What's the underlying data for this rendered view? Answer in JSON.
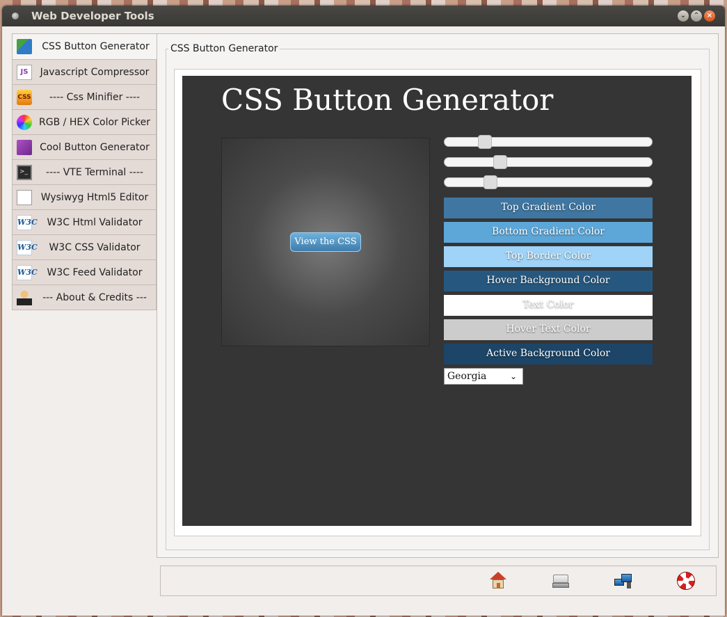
{
  "window": {
    "title": "Web Developer Tools"
  },
  "sidebar": {
    "items": [
      {
        "label": "CSS Button Generator",
        "icon": "css-button-icon",
        "active": true
      },
      {
        "label": "Javascript Compressor",
        "icon": "js-icon"
      },
      {
        "label": "---- Css Minifier ----",
        "icon": "css-icon"
      },
      {
        "label": "RGB / HEX Color Picker",
        "icon": "color-wheel-icon"
      },
      {
        "label": "Cool Button Generator",
        "icon": "cool-button-icon"
      },
      {
        "label": "---- VTE Terminal ----",
        "icon": "terminal-icon"
      },
      {
        "label": "Wysiwyg Html5 Editor",
        "icon": "editor-icon"
      },
      {
        "label": "W3C Html Validator",
        "icon": "w3c-icon"
      },
      {
        "label": "W3C CSS Validator",
        "icon": "w3c-icon"
      },
      {
        "label": "W3C Feed Validator",
        "icon": "w3c-icon"
      },
      {
        "label": "--- About & Credits ---",
        "icon": "person-icon"
      }
    ]
  },
  "main": {
    "group_title": "CSS Button Generator",
    "heading": "CSS Button Generator",
    "preview_button": "View the CSS",
    "sliders": [
      {
        "name": "slider-1",
        "fraction": 0.17
      },
      {
        "name": "slider-2",
        "fraction": 0.25
      },
      {
        "name": "slider-3",
        "fraction": 0.2
      }
    ],
    "color_buttons": [
      {
        "label": "Top Gradient Color",
        "color": "#3f77a2"
      },
      {
        "label": "Bottom Gradient Color",
        "color": "#5da7d8"
      },
      {
        "label": "Top Border Color",
        "color": "#9fd3f7"
      },
      {
        "label": "Hover Background Color",
        "color": "#26587f"
      },
      {
        "label": "Text Color",
        "color": "#ffffff"
      },
      {
        "label": "Hover Text Color",
        "color": "#cccccc"
      },
      {
        "label": "Active Background Color",
        "color": "#1c4567"
      }
    ],
    "font_select": {
      "value": "Georgia"
    }
  },
  "toolbar": {
    "buttons": [
      "home-icon",
      "drive-icon",
      "network-icon",
      "help-icon"
    ]
  }
}
